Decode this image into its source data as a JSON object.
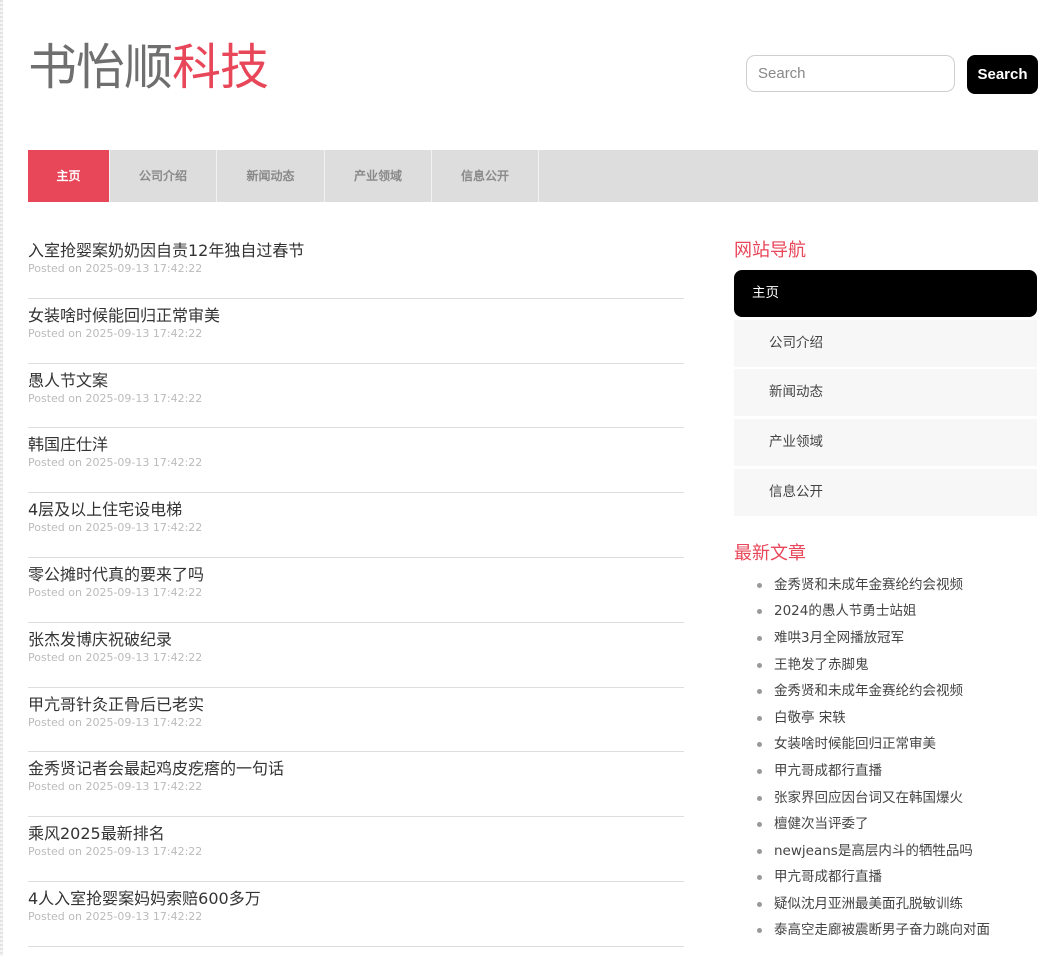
{
  "site": {
    "logo_part1": "书怡顺",
    "logo_part2": "科技"
  },
  "search": {
    "placeholder": "Search",
    "button_label": "Search"
  },
  "topnav": [
    {
      "label": "主页",
      "active": true
    },
    {
      "label": "公司介绍",
      "active": false
    },
    {
      "label": "新闻动态",
      "active": false
    },
    {
      "label": "产业领域",
      "active": false
    },
    {
      "label": "信息公开",
      "active": false
    }
  ],
  "posts": [
    {
      "title": "入室抢婴案奶奶因自责12年独自过春节",
      "meta": "Posted on 2025-09-13 17:42:22"
    },
    {
      "title": "女装啥时候能回归正常审美",
      "meta": "Posted on 2025-09-13 17:42:22"
    },
    {
      "title": "愚人节文案",
      "meta": "Posted on 2025-09-13 17:42:22"
    },
    {
      "title": "韩国庄仕洋",
      "meta": "Posted on 2025-09-13 17:42:22"
    },
    {
      "title": "4层及以上住宅设电梯",
      "meta": "Posted on 2025-09-13 17:42:22"
    },
    {
      "title": "零公摊时代真的要来了吗",
      "meta": "Posted on 2025-09-13 17:42:22"
    },
    {
      "title": "张杰发博庆祝破纪录",
      "meta": "Posted on 2025-09-13 17:42:22"
    },
    {
      "title": "甲亢哥针灸正骨后已老实",
      "meta": "Posted on 2025-09-13 17:42:22"
    },
    {
      "title": "金秀贤记者会最起鸡皮疙瘩的一句话",
      "meta": "Posted on 2025-09-13 17:42:22"
    },
    {
      "title": "乘风2025最新排名",
      "meta": "Posted on 2025-09-13 17:42:22"
    },
    {
      "title": "4人入室抢婴案妈妈索赔600多万",
      "meta": "Posted on 2025-09-13 17:42:22"
    }
  ],
  "sidebar": {
    "nav_title": "网站导航",
    "nav_items": [
      {
        "label": "主页",
        "active": true
      },
      {
        "label": "公司介绍",
        "active": false
      },
      {
        "label": "新闻动态",
        "active": false
      },
      {
        "label": "产业领域",
        "active": false
      },
      {
        "label": "信息公开",
        "active": false
      }
    ],
    "recent_title": "最新文章",
    "recent_items": [
      "金秀贤和未成年金赛纶约会视频",
      "2024的愚人节勇士站姐",
      "难哄3月全网播放冠军",
      "王艳发了赤脚鬼",
      "金秀贤和未成年金赛纶约会视频",
      "白敬亭 宋轶",
      "女装啥时候能回归正常审美",
      "甲亢哥成都行直播",
      "张家界回应因台词又在韩国爆火",
      "檀健次当评委了",
      "newjeans是高层内斗的牺牲品吗",
      "甲亢哥成都行直播",
      "疑似沈月亚洲最美面孔脱敏训练",
      "泰高空走廊被震断男子奋力跳向对面"
    ]
  }
}
